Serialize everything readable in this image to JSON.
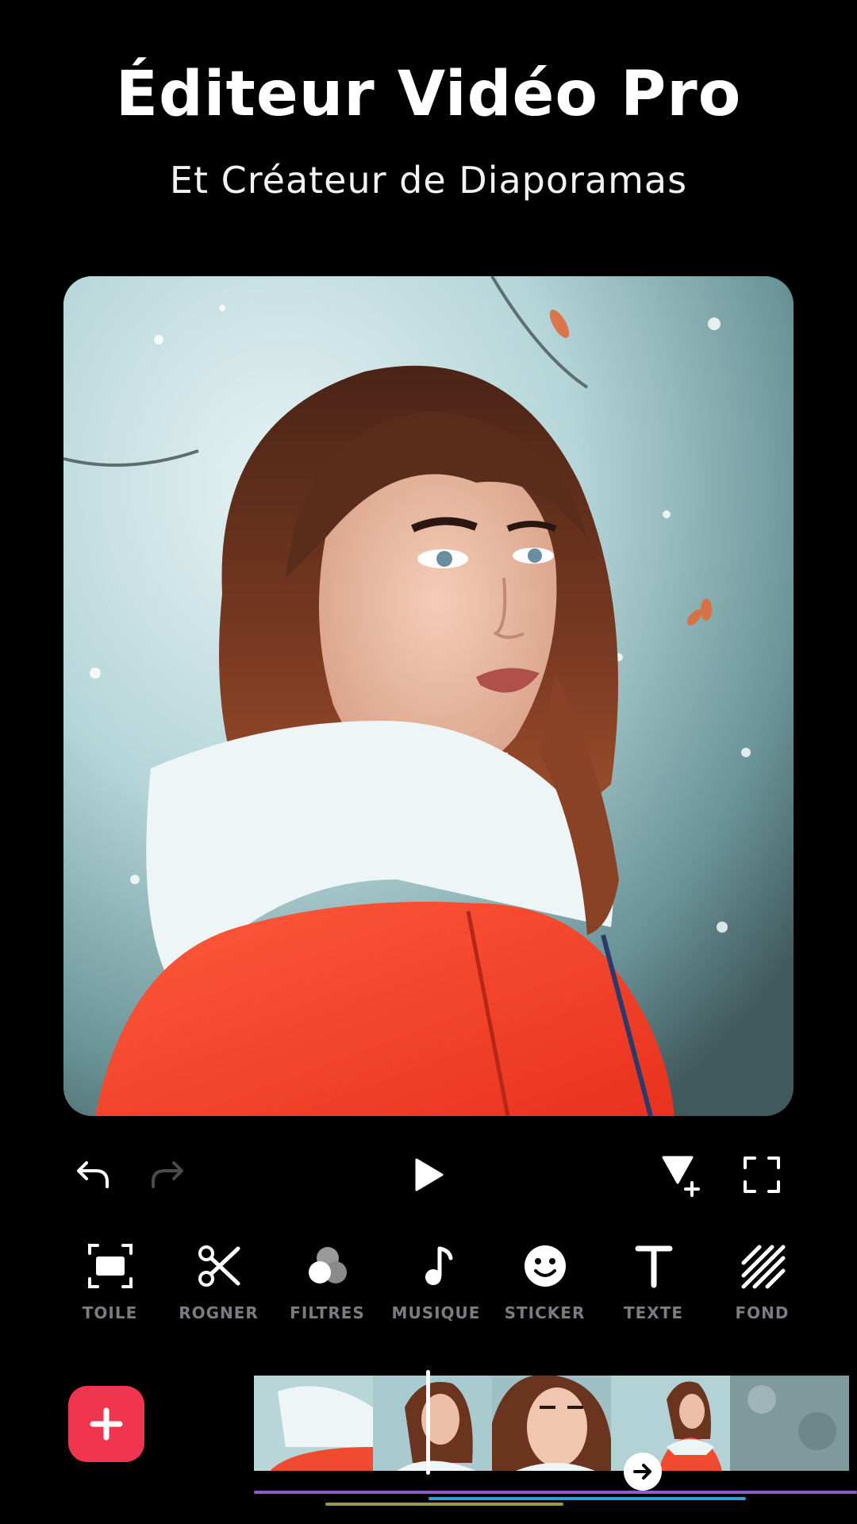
{
  "header": {
    "title": "Éditeur Vidéo Pro",
    "subtitle": "Et Créateur de Diaporamas"
  },
  "controls": {
    "undo_icon": "undo-icon",
    "redo_icon": "redo-icon",
    "play_icon": "play-icon",
    "keyframe_icon": "keyframe-add-icon",
    "fullscreen_icon": "fullscreen-icon"
  },
  "tools": [
    {
      "label": "TOILE",
      "icon": "canvas-icon"
    },
    {
      "label": "ROGNER",
      "icon": "scissors-icon"
    },
    {
      "label": "FILTRES",
      "icon": "filters-icon"
    },
    {
      "label": "MUSIQUE",
      "icon": "music-note-icon"
    },
    {
      "label": "STICKER",
      "icon": "smiley-icon"
    },
    {
      "label": "TEXTE",
      "icon": "text-icon"
    },
    {
      "label": "FOND",
      "icon": "background-stripes-icon"
    }
  ],
  "timeline": {
    "add_icon": "plus-icon",
    "transition_icon": "arrow-right-icon"
  },
  "colors": {
    "accent": "#f0364f",
    "track_purple": "#8c5cc7",
    "track_blue": "#2e9fd8",
    "track_olive": "#9a9a4a",
    "label_gray": "#7c7c80"
  }
}
